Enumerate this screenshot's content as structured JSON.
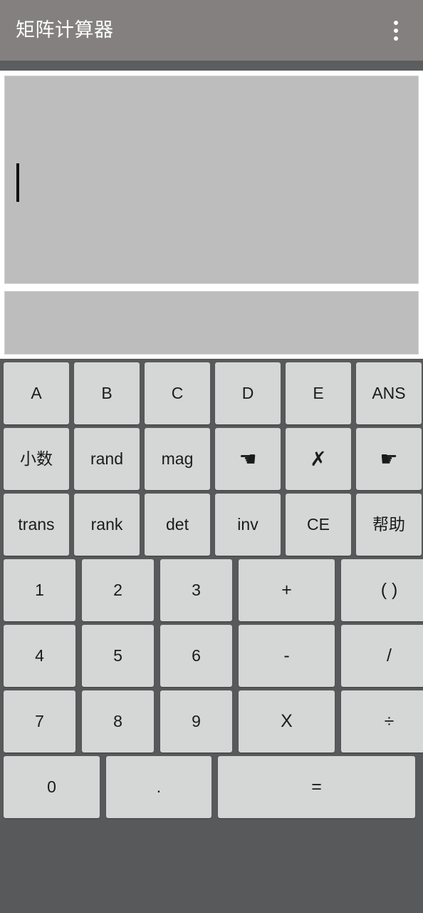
{
  "app": {
    "title": "矩阵计算器",
    "colors": {
      "titlebar_bg": "#858080",
      "titlebar_shadow": "#5b5d5e",
      "display_bg": "#bdbdbd",
      "keypad_bg": "#57595a",
      "key_face": "#d5d7d6",
      "key_text": "#1a1a1a",
      "title_text": "#ffffff",
      "caret": "#111111"
    }
  },
  "titlebar": {
    "title": "矩阵计算器",
    "overflow_icon": "overflow-menu-icon"
  },
  "display": {
    "primary": {
      "value": "",
      "caret_visible": true
    },
    "secondary": {
      "value": ""
    }
  },
  "keypad": {
    "rows": [
      {
        "id": "row-vars",
        "type": "func",
        "keys": [
          {
            "label": "A",
            "name": "key-a"
          },
          {
            "label": "B",
            "name": "key-b"
          },
          {
            "label": "C",
            "name": "key-c"
          },
          {
            "label": "D",
            "name": "key-d"
          },
          {
            "label": "E",
            "name": "key-e"
          },
          {
            "label": "ANS",
            "name": "key-ans"
          }
        ]
      },
      {
        "id": "row-tools",
        "type": "func",
        "keys": [
          {
            "label": "小数",
            "name": "key-decimal-cjk",
            "style": "cjk"
          },
          {
            "label": "rand",
            "name": "key-rand"
          },
          {
            "label": "mag",
            "name": "key-mag"
          },
          {
            "label": "☚",
            "name": "key-cursor-left-hand-icon",
            "style": "glyph"
          },
          {
            "label": "✗",
            "name": "key-backspace-cross-icon",
            "style": "glyph"
          },
          {
            "label": "☛",
            "name": "key-cursor-right-hand-icon",
            "style": "glyph"
          }
        ]
      },
      {
        "id": "row-matrix-ops",
        "type": "func",
        "keys": [
          {
            "label": "trans",
            "name": "key-trans"
          },
          {
            "label": "rank",
            "name": "key-rank"
          },
          {
            "label": "det",
            "name": "key-det"
          },
          {
            "label": "inv",
            "name": "key-inv"
          },
          {
            "label": "CE",
            "name": "key-ce"
          },
          {
            "label": "帮助",
            "name": "key-help-cjk",
            "style": "cjk"
          }
        ]
      },
      {
        "id": "row-123",
        "type": "num",
        "keys": [
          {
            "label": "1",
            "name": "key-1"
          },
          {
            "label": "2",
            "name": "key-2"
          },
          {
            "label": "3",
            "name": "key-3"
          },
          {
            "label": "+",
            "name": "key-plus",
            "style": "op",
            "wide": true
          },
          {
            "label": "( )",
            "name": "key-parentheses",
            "style": "op",
            "wide": true
          }
        ]
      },
      {
        "id": "row-456",
        "type": "num",
        "keys": [
          {
            "label": "4",
            "name": "key-4"
          },
          {
            "label": "5",
            "name": "key-5"
          },
          {
            "label": "6",
            "name": "key-6"
          },
          {
            "label": "-",
            "name": "key-minus",
            "style": "op",
            "wide": true
          },
          {
            "label": "/",
            "name": "key-slash",
            "style": "op",
            "wide": true
          }
        ]
      },
      {
        "id": "row-789",
        "type": "num",
        "keys": [
          {
            "label": "7",
            "name": "key-7"
          },
          {
            "label": "8",
            "name": "key-8"
          },
          {
            "label": "9",
            "name": "key-9"
          },
          {
            "label": "X",
            "name": "key-multiply-x",
            "style": "op",
            "wide": true
          },
          {
            "label": "÷",
            "name": "key-divide",
            "style": "op",
            "wide": true
          }
        ]
      },
      {
        "id": "row-zero",
        "type": "bottom",
        "keys": [
          {
            "label": "0",
            "name": "key-0",
            "sizeClass": "k-zero"
          },
          {
            "label": ".",
            "name": "key-dot",
            "sizeClass": "k-dot"
          },
          {
            "label": "=",
            "name": "key-equals",
            "sizeClass": "k-eq",
            "style": "op"
          }
        ]
      }
    ]
  }
}
